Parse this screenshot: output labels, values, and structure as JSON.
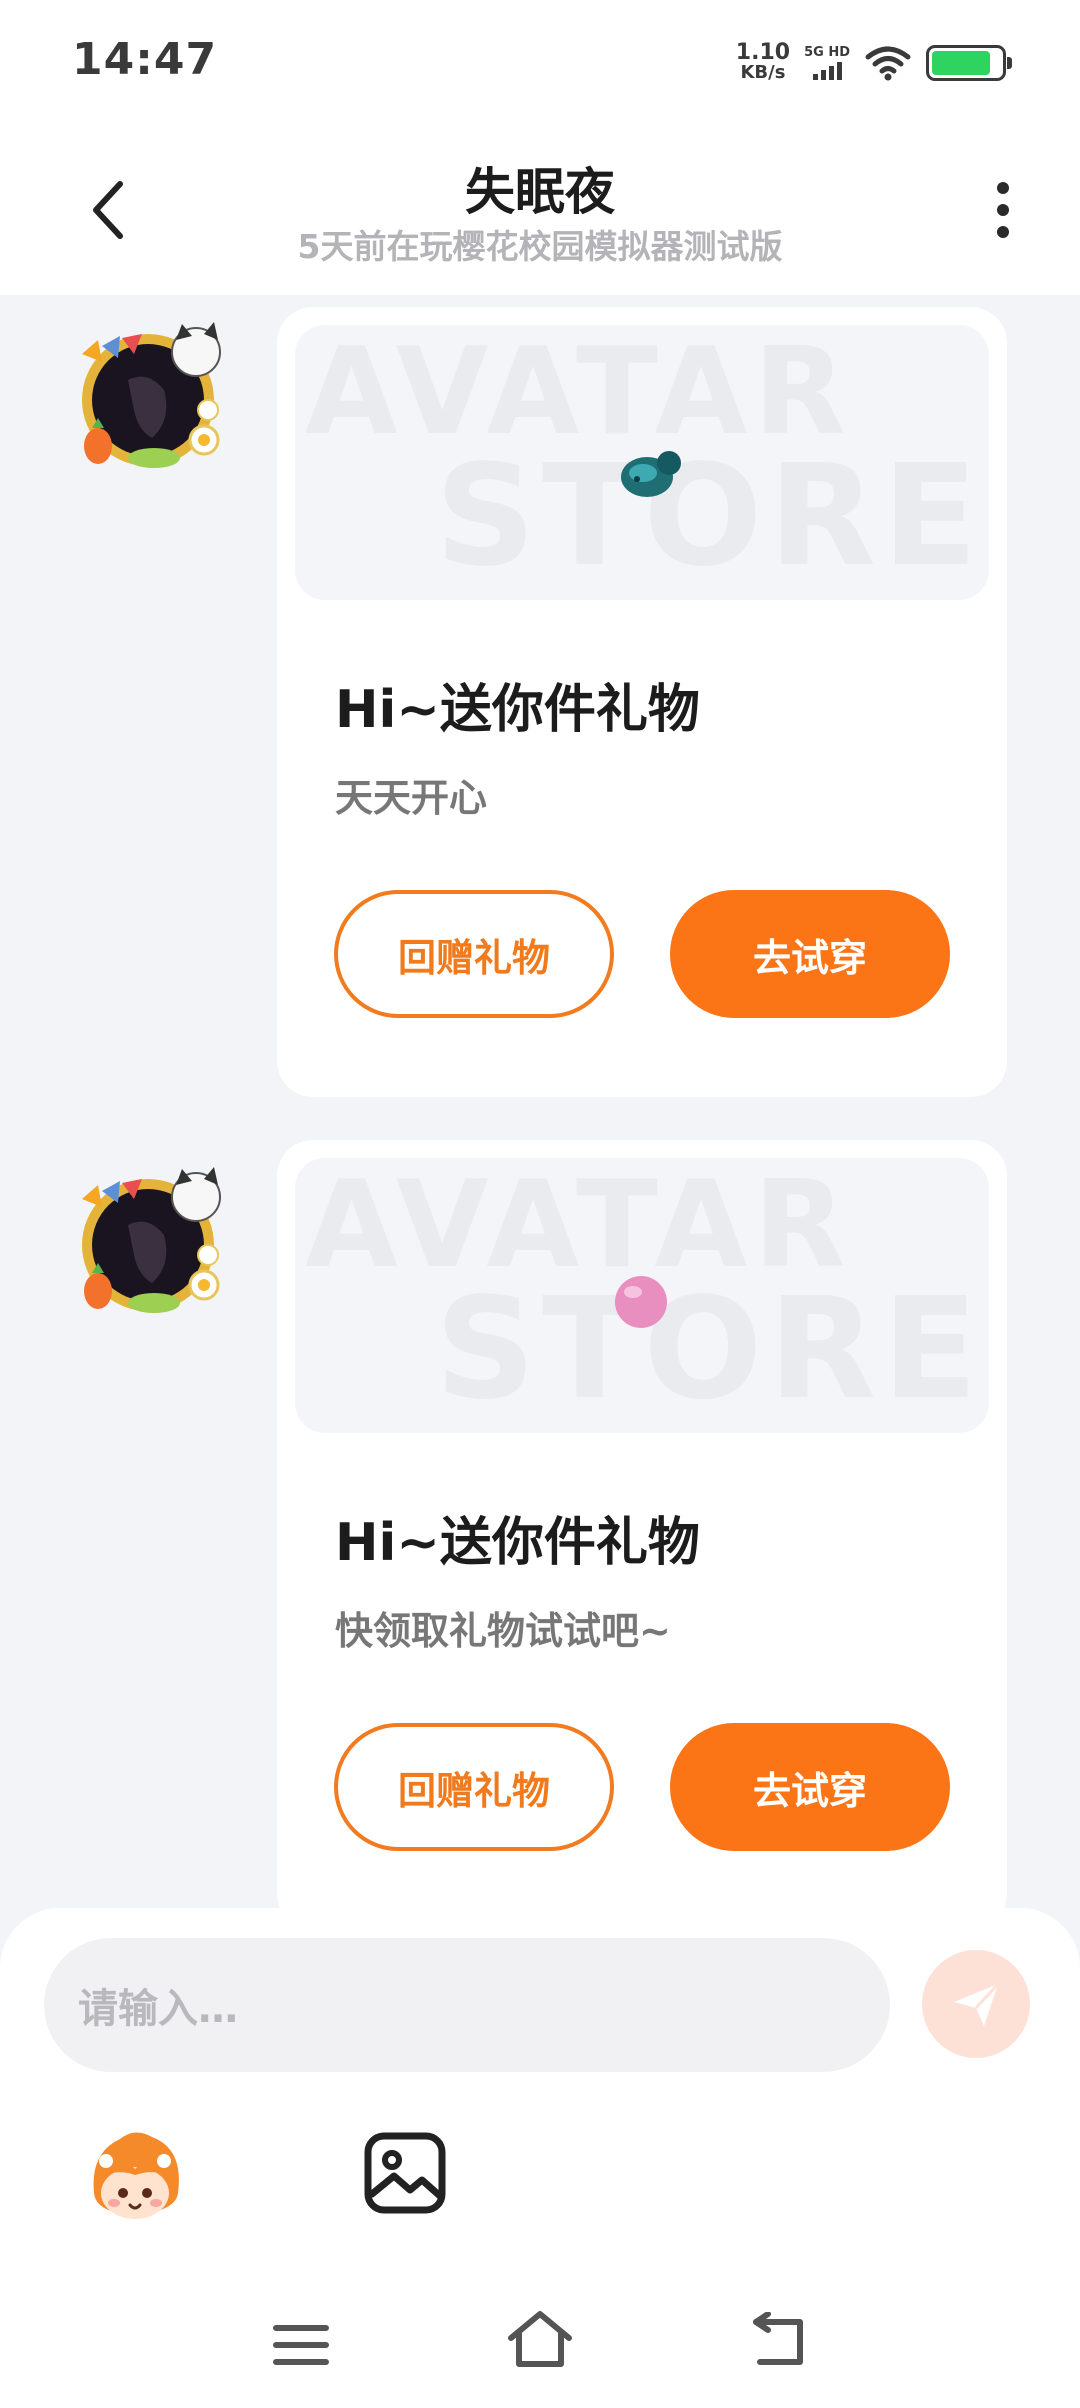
{
  "status_bar": {
    "time": "14:47",
    "net_speed_value": "1.10",
    "net_speed_unit": "KB/s",
    "network_type": "5G HD",
    "battery_level": 0.85,
    "battery_color": "#2fd35f"
  },
  "header": {
    "title": "失眠夜",
    "subtitle": "5天前在玩樱花校园模拟器测试版",
    "back_icon": "chevron-left-icon",
    "more_icon": "more-vertical-icon"
  },
  "messages": [
    {
      "watermark_line1": "AVATAR",
      "watermark_line2": "STORE",
      "title": "Hi~送你件礼物",
      "subtitle": "天天开心",
      "return_gift_label": "回赠礼物",
      "try_on_label": "去试穿",
      "gift_icon": "pacifier-icon"
    },
    {
      "watermark_line1": "AVATAR",
      "watermark_line2": "STORE",
      "title": "Hi~送你件礼物",
      "subtitle": "快领取礼物试试吧~",
      "return_gift_label": "回赠礼物",
      "try_on_label": "去试穿",
      "gift_icon": "pink-ball-icon"
    }
  ],
  "input_bar": {
    "placeholder": "请输入…",
    "send_icon": "send-icon",
    "emoji_icon": "sticker-icon",
    "image_icon": "image-icon"
  },
  "nav_bar": {
    "menu_icon": "menu-icon",
    "home_icon": "home-icon",
    "back_icon": "back-icon"
  },
  "colors": {
    "accent": "#fb7416",
    "background": "#f3f4f8"
  }
}
